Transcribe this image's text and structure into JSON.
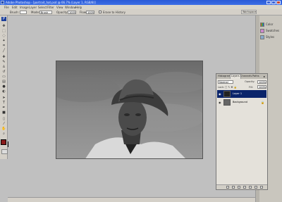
{
  "window": {
    "title": "Adobe Photoshop - [portrait_hat.psd @ 66.7% (Layer 1, RGB/8)]",
    "controls": [
      "minimize",
      "maximize",
      "close"
    ]
  },
  "menubar": {
    "items": [
      "File",
      "Edit",
      "Image",
      "Layer",
      "Select",
      "Filter",
      "View",
      "Window",
      "Help"
    ]
  },
  "options": {
    "brush_label": "Brush:",
    "mode_label": "Mode:",
    "mode_value": "Brush",
    "opacity_label": "Opacity:",
    "opacity_value": "100%",
    "flow_label": "Flow:",
    "flow_value": "100%",
    "erase_history_label": "Erase to History",
    "workspace_label": "Workspace"
  },
  "right_panels": {
    "items": [
      "Color",
      "Swatches",
      "Styles"
    ]
  },
  "layers_panel": {
    "tabs": [
      "Histogram",
      "Layers",
      "Channels",
      "Paths"
    ],
    "active_tab": "Layers",
    "blend_mode": "Normal",
    "opacity_label": "Opacity:",
    "opacity_value": "100%",
    "lock_label": "Lock:",
    "fill_label": "Fill:",
    "fill_value": "100%",
    "layers": [
      {
        "name": "Layer 1",
        "selected": true
      },
      {
        "name": "Background",
        "selected": false
      }
    ]
  },
  "colors": {
    "titlebar": "#2a5bd7",
    "selection": "#0a246a",
    "foreground_swatch": "#8b1c1c",
    "background_swatch": "#ffffff"
  },
  "toolbox": {
    "tools": [
      "move-icon",
      "marquee-icon",
      "lasso-icon",
      "magic-wand-icon",
      "crop-icon",
      "slice-icon",
      "healing-icon",
      "brush-icon",
      "clone-stamp-icon",
      "history-brush-icon",
      "eraser-icon",
      "gradient-icon",
      "blur-icon",
      "dodge-icon",
      "path-selection-icon",
      "type-icon",
      "pen-icon",
      "shape-icon",
      "notes-icon",
      "eyedropper-icon",
      "hand-icon",
      "zoom-icon"
    ]
  }
}
